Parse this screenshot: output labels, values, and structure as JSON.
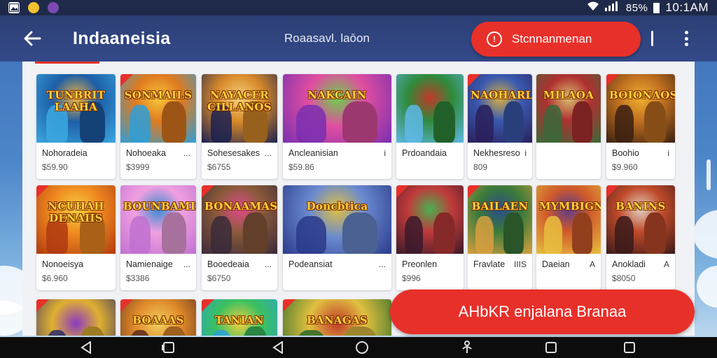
{
  "status_bar": {
    "left_icons": [
      "image-icon",
      "emoji-icon",
      "game-app-icon"
    ],
    "battery": "85%",
    "time": "10:1AM",
    "right_text": "85% ▮ 10:1AM"
  },
  "app_bar": {
    "title": "Indaaneisia",
    "subtitle": "Roaasavl. laōon",
    "cta_label": "Stcnnanmenan",
    "divider_glyph": "|"
  },
  "games": [
    {
      "thumb_title": "TUNBRIT LAAHA",
      "name": "Nohoradeia",
      "extra": "",
      "price": "$59.90",
      "ribbon": false,
      "colors": [
        "#3ba8e0",
        "#1d5fa8",
        "#f2b23a"
      ]
    },
    {
      "thumb_title": "SONMAILS",
      "name": "Nohoeaka",
      "extra": "...",
      "price": "$3999",
      "ribbon": true,
      "colors": [
        "#2d9fd8",
        "#e07a20",
        "#f5c63a"
      ]
    },
    {
      "thumb_title": "NAYACER CILLANOS",
      "name": "Sohesesakes",
      "extra": "...",
      "price": "$6755",
      "ribbon": false,
      "colors": [
        "#1a2050",
        "#d88a2a",
        "#f4d27a"
      ]
    },
    {
      "thumb_title": "NAKCAIN",
      "name": "Ancleanisian",
      "extra": "i",
      "price": "$59.86",
      "ribbon": false,
      "colors": [
        "#7a2fb0",
        "#e04ea0",
        "#6bd04a"
      ]
    },
    {
      "thumb_title": "",
      "name": "Prdoandaia",
      "extra": "",
      "price": "",
      "ribbon": false,
      "colors": [
        "#5fb8e8",
        "#2f8a3a",
        "#c03a2a"
      ]
    },
    {
      "thumb_title": "NAOHARLIE",
      "name": "Nekhesreso Reola",
      "extra": "i",
      "price": "809",
      "ribbon": true,
      "colors": [
        "#2a1f5a",
        "#3a5ab0",
        "#d8b040"
      ]
    },
    {
      "thumb_title": "MILAOA",
      "name": "",
      "extra": "",
      "price": "",
      "ribbon": false,
      "colors": [
        "#3a6a3a",
        "#b03030",
        "#d8c070"
      ]
    },
    {
      "thumb_title": "BOIONAOS",
      "name": "Boohio",
      "extra": "i",
      "price": "$9.960",
      "ribbon": true,
      "colors": [
        "#3a2010",
        "#c07020",
        "#f0b030"
      ]
    },
    {
      "thumb_title": "NCUHAH DENAIIS",
      "name": "Nonoeisya",
      "extra": "",
      "price": "$6.960",
      "ribbon": true,
      "colors": [
        "#b03a10",
        "#f08a20",
        "#f5d040"
      ]
    },
    {
      "thumb_title": "BOUNBAMIS",
      "name": "Namienaige",
      "extra": "...",
      "price": "$3386",
      "ribbon": false,
      "colors": [
        "#c070d0",
        "#f0a0e0",
        "#3a8ad0"
      ]
    },
    {
      "thumb_title": "BONAAMAS",
      "name": "Booedeaia",
      "extra": "...",
      "price": "$6750",
      "ribbon": true,
      "colors": [
        "#3a2a3a",
        "#8a5a3a",
        "#e04a8a"
      ]
    },
    {
      "thumb_title": "Doncbtica",
      "name": "Podeansiat",
      "extra": "...",
      "price": "",
      "ribbon": false,
      "colors": [
        "#2a3a8a",
        "#6a8ad0",
        "#e0c040"
      ]
    },
    {
      "thumb_title": "",
      "name": "Preonlen",
      "extra": "",
      "price": "$996",
      "ribbon": true,
      "colors": [
        "#3a1a2a",
        "#c03a3a",
        "#4ab050"
      ]
    },
    {
      "thumb_title": "BAILAEN",
      "name": "Fravlate",
      "extra": "IIIS",
      "price": "",
      "ribbon": true,
      "colors": [
        "#d8a040",
        "#3a7a3a",
        "#2a4a8a"
      ]
    },
    {
      "thumb_title": "MYMBIGNIS",
      "name": "Daeian",
      "extra": "A",
      "price": "",
      "ribbon": false,
      "colors": [
        "#e8c040",
        "#d05a2a",
        "#5a3a8a"
      ]
    },
    {
      "thumb_title": "BANINS",
      "name": "Anokladi",
      "extra": "A",
      "price": "$8050",
      "ribbon": true,
      "colors": [
        "#3a1a1a",
        "#c04a2a",
        "#e0d0c0"
      ]
    },
    {
      "thumb_title": "",
      "name": "",
      "extra": "",
      "price": "",
      "ribbon": true,
      "colors": [
        "#2a2a6a",
        "#e0b030",
        "#8a3ac0"
      ]
    },
    {
      "thumb_title": "BOAAAS",
      "name": "",
      "extra": "",
      "price": "",
      "ribbon": true,
      "colors": [
        "#5a2a1a",
        "#e08a2a",
        "#f0d060"
      ]
    },
    {
      "thumb_title": "TANIAN",
      "name": "",
      "extra": "",
      "price": "",
      "ribbon": true,
      "colors": [
        "#2aa0d8",
        "#3ac060",
        "#f0d040"
      ]
    },
    {
      "thumb_title": "BANAGAS",
      "name": "",
      "extra": "",
      "price": "",
      "ribbon": true,
      "colors": [
        "#2a6a2a",
        "#e0c040",
        "#c03a2a"
      ]
    }
  ],
  "floating_cta": {
    "label": "AHbKR enjalana Branaa"
  },
  "nav_bar": {
    "buttons": [
      "back-triangle",
      "recent-square",
      "back-triangle",
      "home-circle",
      "accessibility",
      "square",
      "square"
    ]
  }
}
